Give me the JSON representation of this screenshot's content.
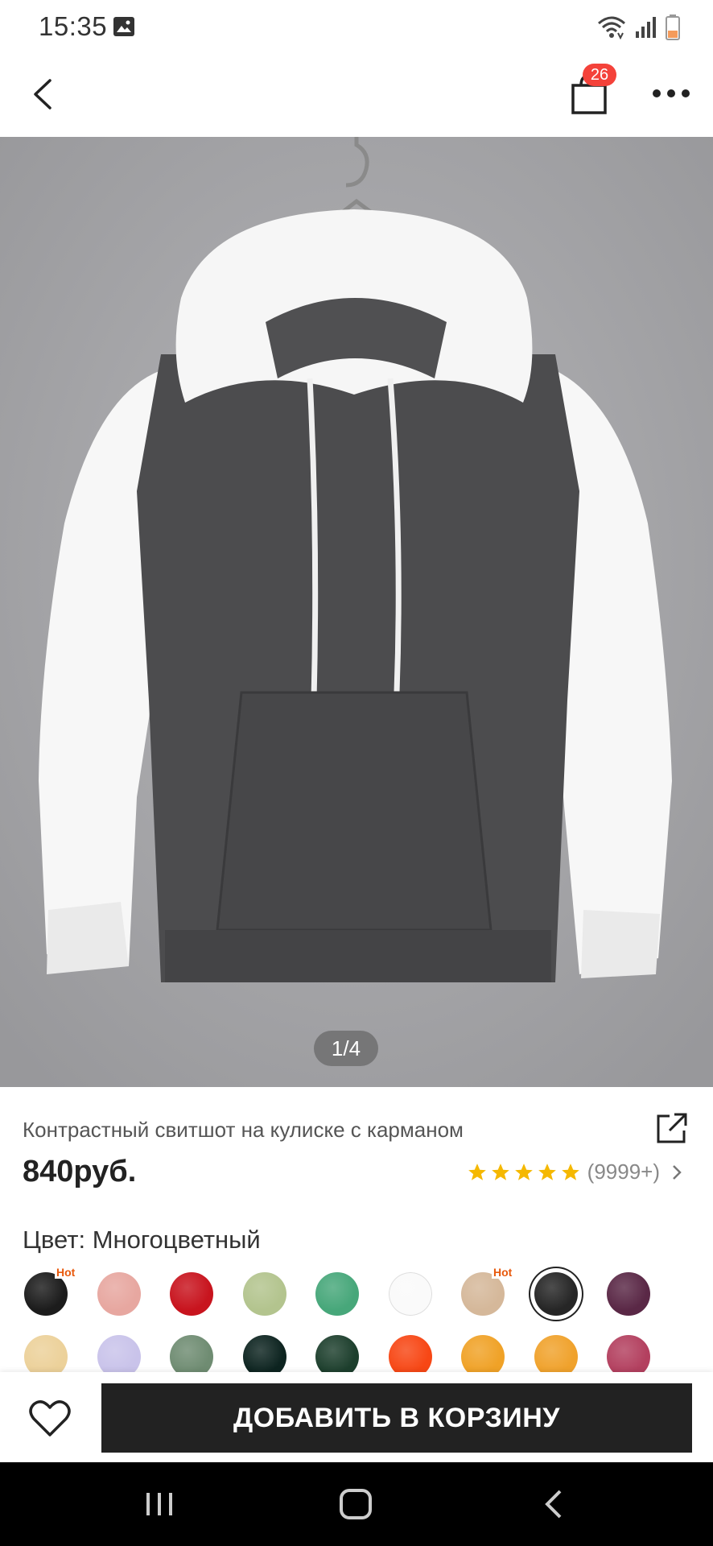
{
  "status": {
    "time": "15:35",
    "icons": [
      "image-icon",
      "wifi-icon",
      "signal-icon",
      "battery-icon"
    ]
  },
  "nav": {
    "back_icon": "chevron-left-icon",
    "cart_count": "26",
    "cart_icon": "shopping-bag-icon",
    "more_icon": "more-dots-icon"
  },
  "product": {
    "image_counter": "1/4",
    "title": "Контрастный свитшот на кулиске с карманом",
    "price": "840руб.",
    "rating_stars": 5,
    "rating_count": "(9999+)",
    "color_label": "Цвет: Многоцветный"
  },
  "swatches": [
    {
      "color": "#1c1c1c",
      "hot": true,
      "hot_label": "Hot"
    },
    {
      "color": "#e7a7a0"
    },
    {
      "color": "#c8141e"
    },
    {
      "color": "#b3c48e"
    },
    {
      "color": "#47a77a"
    },
    {
      "color": "#fafafa",
      "light": true
    },
    {
      "color": "#d5b89a",
      "hot": true,
      "hot_label": "Hot"
    },
    {
      "color": "#262626",
      "selected": true
    },
    {
      "color": "#5a2846"
    },
    {
      "color": "#ecd19a"
    },
    {
      "color": "#c9c3ea"
    },
    {
      "color": "#6f8c72"
    },
    {
      "color": "#0d2420"
    },
    {
      "color": "#1d3f2d"
    },
    {
      "color": "#f74715"
    },
    {
      "color": "#f0a227"
    },
    {
      "color": "#f0a22c"
    },
    {
      "color": "#b3405f"
    }
  ],
  "bottom": {
    "add_to_cart": "ДОБАВИТЬ В КОРЗИНУ",
    "fav_icon": "heart-icon"
  },
  "colors": {
    "accent": "#f4423a",
    "button_bg": "#222222",
    "star": "#f5b800",
    "image_bg": "#a3a3a6"
  }
}
